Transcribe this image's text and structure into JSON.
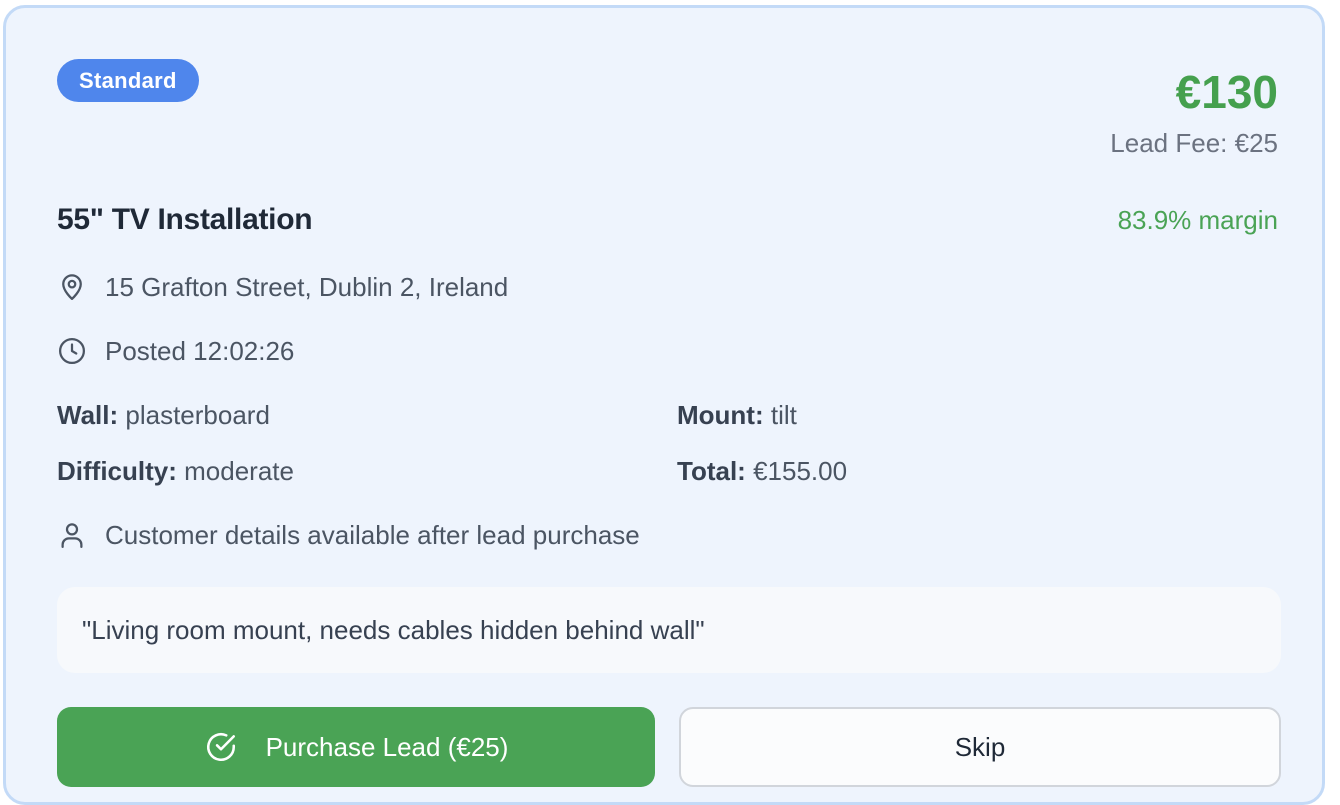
{
  "badge": "Standard",
  "price": "€130",
  "lead_fee": "Lead Fee: €25",
  "title": "55\" TV Installation",
  "margin": "83.9% margin",
  "location": {
    "icon": "map-pin-icon",
    "text": "15 Grafton Street, Dublin 2, Ireland"
  },
  "posted": {
    "icon": "clock-icon",
    "text": "Posted 12:02:26"
  },
  "details": {
    "wall": {
      "label": "Wall:",
      "value": "plasterboard"
    },
    "mount": {
      "label": "Mount:",
      "value": "tilt"
    },
    "difficulty": {
      "label": "Difficulty:",
      "value": "moderate"
    },
    "total": {
      "label": "Total:",
      "value": "€155.00"
    }
  },
  "customer": {
    "icon": "user-icon",
    "text": "Customer details available after lead purchase"
  },
  "notes": "\"Living room mount, needs cables hidden behind wall\"",
  "buttons": {
    "purchase": {
      "icon": "check-circle-icon",
      "label": "Purchase Lead (€25)"
    },
    "skip": {
      "label": "Skip"
    }
  },
  "colors": {
    "badge_bg": "#4f86ec",
    "price_green": "#45a04e",
    "purchase_bg": "#4aa355",
    "card_bg": "#eef4fd",
    "card_border": "#c3daf7"
  }
}
